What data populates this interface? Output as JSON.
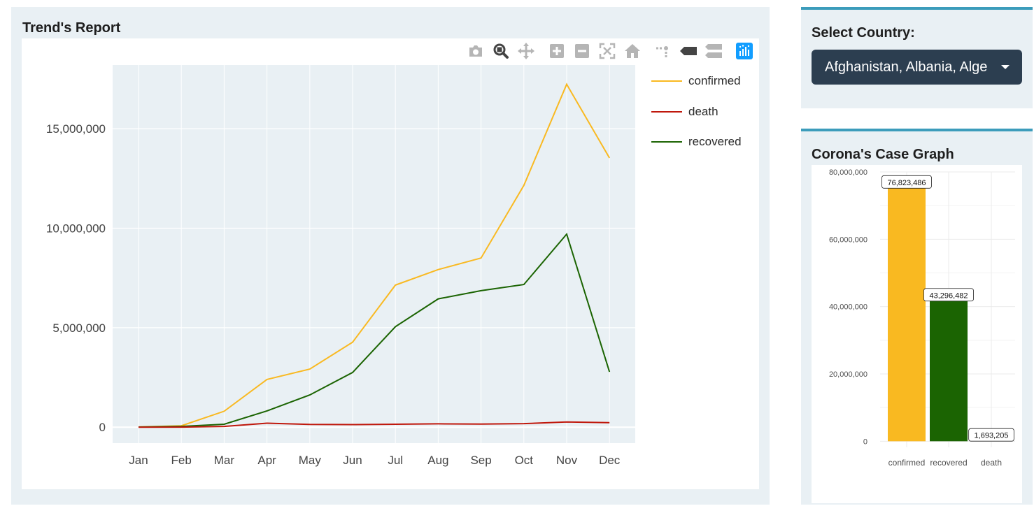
{
  "trend_panel": {
    "title": "Trend's Report"
  },
  "modebar": {
    "icons": [
      "camera-icon",
      "zoom-icon",
      "pan-icon",
      "zoom-in-icon",
      "zoom-out-icon",
      "autoscale-icon",
      "reset-axes-icon",
      "spike-lines-icon",
      "hover-closest-icon",
      "hover-compare-icon",
      "plotly-logo-icon"
    ],
    "active_color": "#444444",
    "inactive_color": "#b5b5b5",
    "logo_color": "#119dff"
  },
  "country_panel": {
    "label": "Select Country:",
    "selected_value": "Afghanistan, Albania, Alge"
  },
  "case_panel": {
    "title": "Corona's Case Graph"
  },
  "colors": {
    "confirmed": "#f9b921",
    "death": "#c0180c",
    "recovered": "#1b6402",
    "plot_bg": "#e9f0f4",
    "accent": "#3c9cbb",
    "dropdown_bg": "#2c3e50"
  },
  "chart_data": [
    {
      "type": "line",
      "categories": [
        "Jan",
        "Feb",
        "Mar",
        "Apr",
        "May",
        "Jun",
        "Jul",
        "Aug",
        "Sep",
        "Oct",
        "Nov",
        "Dec"
      ],
      "series": [
        {
          "name": "confirmed",
          "values": [
            10000,
            70000,
            800000,
            2400000,
            2920000,
            4270000,
            7140000,
            7920000,
            8500000,
            12150000,
            17230000,
            13530000
          ]
        },
        {
          "name": "death",
          "values": [
            300,
            3000,
            40000,
            200000,
            140000,
            130000,
            150000,
            170000,
            160000,
            180000,
            260000,
            230000
          ]
        },
        {
          "name": "recovered",
          "values": [
            8000,
            40000,
            150000,
            820000,
            1620000,
            2750000,
            5050000,
            6450000,
            6860000,
            7170000,
            9700000,
            2780000
          ]
        }
      ],
      "ylim": [
        -800000,
        18200000
      ],
      "yticks": [
        0,
        5000000,
        10000000,
        15000000
      ],
      "ytick_labels": [
        "0",
        "5,000,000",
        "10,000,000",
        "15,000,000"
      ],
      "grid": true,
      "legend": "right"
    },
    {
      "type": "bar",
      "categories": [
        "confirmed",
        "recovered",
        "death"
      ],
      "values": [
        76823486,
        43296482,
        1693205
      ],
      "labels": [
        "76,823,486",
        "43,296,482",
        "1,693,205"
      ],
      "ylim": [
        -1800000,
        80000000
      ],
      "yticks": [
        0,
        20000000,
        40000000,
        60000000,
        80000000
      ],
      "ytick_labels": [
        "0",
        "20,000,000",
        "40,000,000",
        "60,000,000",
        "80,000,000"
      ],
      "grid": true
    }
  ]
}
